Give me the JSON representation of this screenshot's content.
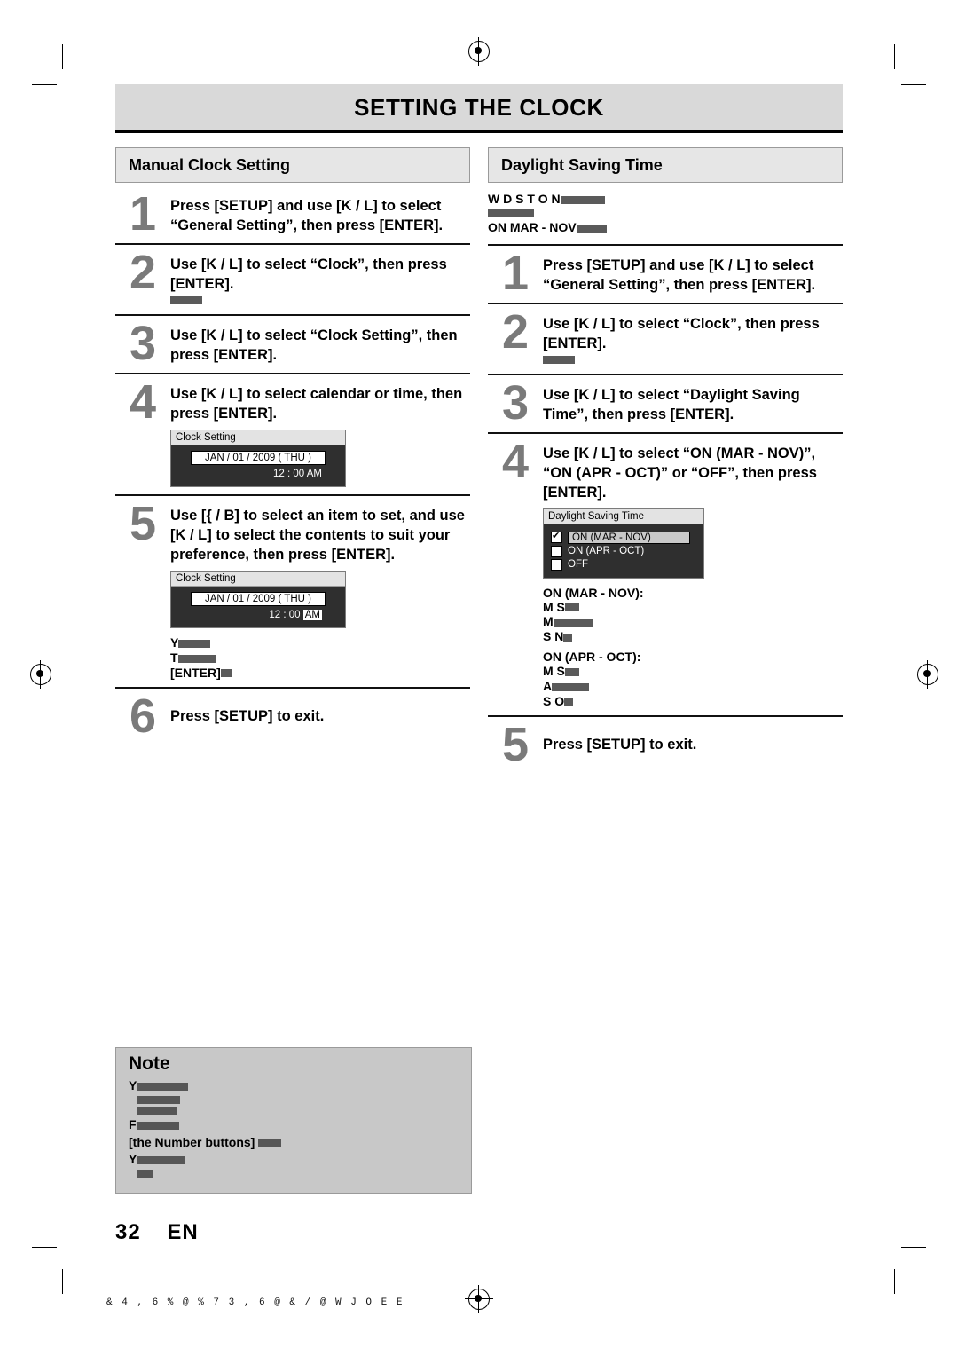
{
  "page": {
    "title": "SETTING THE CLOCK",
    "page_number": "32",
    "page_lang": "EN",
    "footer_text": "& 4 ,  6 % @ % 7 3   , 6 @ & / @ W     J O E E"
  },
  "left_column": {
    "heading": "Manual Clock Setting",
    "steps": [
      {
        "num": "1",
        "text": "Press [SETUP] and use [K / L] to select “General Setting”, then press [ENTER]."
      },
      {
        "num": "2",
        "text": "Use [K / L] to select “Clock”, then press [ENTER]."
      },
      {
        "num": "3",
        "text": "Use [K / L] to select “Clock Setting”, then press [ENTER]."
      },
      {
        "num": "4",
        "text": "Use [K / L] to select calendar or time, then press [ENTER]."
      },
      {
        "num": "5",
        "text": "Use [{ / B] to select an item to set, and use [K / L] to select the contents to suit your preference, then press [ENTER]."
      },
      {
        "num": "6",
        "text": "Press [SETUP] to exit."
      }
    ],
    "osd_step4": {
      "title": "Clock Setting",
      "date": "JAN / 01 / 2009 ( THU )",
      "time": "12 : 00 AM"
    },
    "osd_step5": {
      "title": "Clock Setting",
      "date": "JAN / 01 / 2009 ( THU )",
      "time_prefix": "12 : 00",
      "time_highlight": "AM"
    },
    "step5_notes": {
      "line1": "Y",
      "line2": "T",
      "line3": "[ENTER]"
    }
  },
  "right_column": {
    "heading": "Daylight Saving Time",
    "intro_lines": [
      "W D S T O N",
      "",
      "ON MAR - NOV"
    ],
    "steps": [
      {
        "num": "1",
        "text": "Press [SETUP] and use [K / L] to select “General Setting”, then press [ENTER]."
      },
      {
        "num": "2",
        "text": "Use [K / L] to select “Clock”, then press [ENTER]."
      },
      {
        "num": "3",
        "text": "Use [K / L] to select “Daylight Saving Time”, then press [ENTER]."
      },
      {
        "num": "4",
        "text": "Use [K / L] to select “ON (MAR - NOV)”, “ON (APR - OCT)” or “OFF”, then press [ENTER]."
      },
      {
        "num": "5",
        "text": "Press [SETUP] to exit."
      }
    ],
    "osd": {
      "title": "Daylight Saving Time",
      "options": [
        {
          "label": "ON (MAR - NOV)",
          "checked": true,
          "selected": true
        },
        {
          "label": "ON (APR - OCT)",
          "checked": false,
          "selected": false
        },
        {
          "label": "OFF",
          "checked": false,
          "selected": false
        }
      ]
    },
    "caption_groups": [
      {
        "heading": "ON (MAR - NOV):",
        "lines": [
          "M        S",
          "M",
          "S   N"
        ]
      },
      {
        "heading": "ON (APR - OCT):",
        "lines": [
          "M        S",
          "A",
          "S   O"
        ]
      }
    ]
  },
  "note": {
    "title": "Note",
    "lines": [
      "Y",
      "",
      "",
      "F"
    ],
    "keyword": "[the Number buttons]",
    "tail_lines": [
      "Y",
      ""
    ]
  }
}
